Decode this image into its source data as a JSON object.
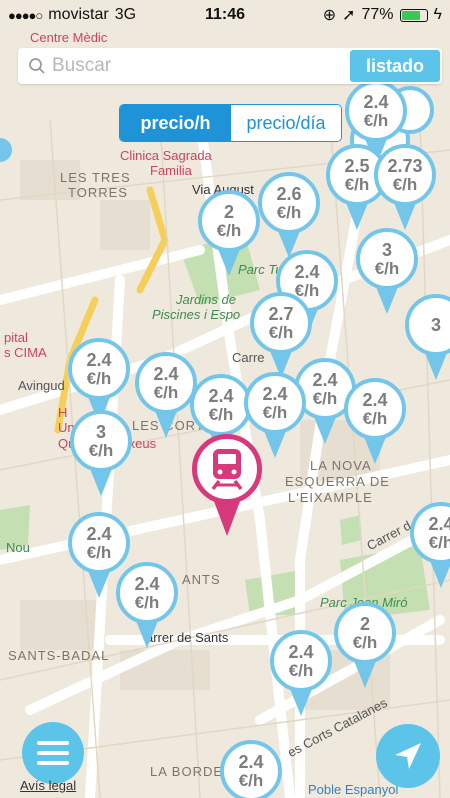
{
  "status_bar": {
    "carrier": "movistar",
    "network": "3G",
    "time": "11:46",
    "battery": "77%",
    "battery_level": 0.77
  },
  "search": {
    "placeholder": "Buscar",
    "list_button": "listado"
  },
  "toggle": {
    "option_hour": "precio/h",
    "option_day": "precio/día",
    "selected": "precio/h"
  },
  "map_labels": {
    "centre_medic": "Centre Mèdic",
    "clinica": "Clinica Sagrada",
    "clinica2": "Familia",
    "tres_torres1": "LES TRES",
    "tres_torres2": "TORRES",
    "via_august": "Via August",
    "parc_tu": "Parc Tu",
    "jardins1": "Jardins de",
    "jardins2": "Piscines i Espo",
    "hospital1": "pital",
    "hospital2": "s CIMA",
    "avinguda": "Avingud",
    "carrer": "Carre",
    "les_cort": "LES CORT",
    "hospital_h": "H",
    "un_io": "Un        io",
    "quir": "Quir",
    "dexeus": "Dexeus",
    "nova_esquerra1": "LA NOVA",
    "nova_esquerra2": "ESQUERRA DE",
    "nova_esquerra3": "L'EIXAMPLE",
    "nou": "Nou",
    "ants": "ANTS",
    "carrer_d": "Carrer d",
    "parc_joan_miro": "Parc      Joan Miró",
    "carrer_sants": "arrer de Sants",
    "sants_badal": "SANTS-BADAL",
    "corts_catalanes": "es Corts Catalanes",
    "la_borde": "LA BORDE",
    "poble_espanyol": "Poble Espanyol"
  },
  "pins": [
    {
      "price": "2.4",
      "unit": "€/h"
    },
    {
      "price": "2.5",
      "unit": "€/h"
    },
    {
      "price": "2.73",
      "unit": "€/h"
    },
    {
      "price": "2.6",
      "unit": "€/h"
    },
    {
      "price": "2",
      "unit": "€/h"
    },
    {
      "price": "3",
      "unit": "€/h"
    },
    {
      "price": "2.4",
      "unit": "€/h"
    },
    {
      "price": "2.7",
      "unit": "€/h"
    },
    {
      "price": "3",
      "unit": ""
    },
    {
      "price": "2.4",
      "unit": "€/h"
    },
    {
      "price": "2.4",
      "unit": "€/h"
    },
    {
      "price": "2.4",
      "unit": "€/h"
    },
    {
      "price": "2.4",
      "unit": "€/h"
    },
    {
      "price": "2.4",
      "unit": "€/h"
    },
    {
      "price": "2.4",
      "unit": "€/h"
    },
    {
      "price": "3",
      "unit": "€/h"
    },
    {
      "price": "2.4",
      "unit": "€/h"
    },
    {
      "price": "2.4",
      "unit": "€/h"
    },
    {
      "price": "2.4",
      "unit": "€/h"
    },
    {
      "price": "2",
      "unit": "€/h"
    },
    {
      "price": "2.4",
      "unit": "€/h"
    },
    {
      "price": "2.4",
      "unit": "€/h"
    }
  ],
  "footer": {
    "legal": "Avís legal"
  },
  "colors": {
    "accent": "#5cc4e9",
    "segment_blue": "#1e93d8",
    "pin_border": "#73c6ea",
    "station": "#d6397c",
    "map_bg": "#efe9dd"
  }
}
